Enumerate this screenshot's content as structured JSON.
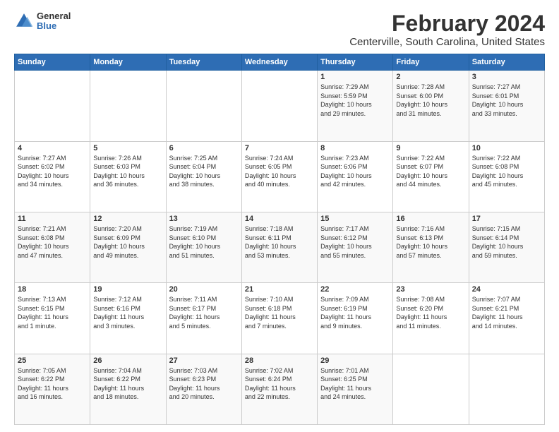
{
  "logo": {
    "general": "General",
    "blue": "Blue"
  },
  "title": "February 2024",
  "subtitle": "Centerville, South Carolina, United States",
  "days_of_week": [
    "Sunday",
    "Monday",
    "Tuesday",
    "Wednesday",
    "Thursday",
    "Friday",
    "Saturday"
  ],
  "weeks": [
    [
      {
        "day": "",
        "info": ""
      },
      {
        "day": "",
        "info": ""
      },
      {
        "day": "",
        "info": ""
      },
      {
        "day": "",
        "info": ""
      },
      {
        "day": "1",
        "info": "Sunrise: 7:29 AM\nSunset: 5:59 PM\nDaylight: 10 hours\nand 29 minutes."
      },
      {
        "day": "2",
        "info": "Sunrise: 7:28 AM\nSunset: 6:00 PM\nDaylight: 10 hours\nand 31 minutes."
      },
      {
        "day": "3",
        "info": "Sunrise: 7:27 AM\nSunset: 6:01 PM\nDaylight: 10 hours\nand 33 minutes."
      }
    ],
    [
      {
        "day": "4",
        "info": "Sunrise: 7:27 AM\nSunset: 6:02 PM\nDaylight: 10 hours\nand 34 minutes."
      },
      {
        "day": "5",
        "info": "Sunrise: 7:26 AM\nSunset: 6:03 PM\nDaylight: 10 hours\nand 36 minutes."
      },
      {
        "day": "6",
        "info": "Sunrise: 7:25 AM\nSunset: 6:04 PM\nDaylight: 10 hours\nand 38 minutes."
      },
      {
        "day": "7",
        "info": "Sunrise: 7:24 AM\nSunset: 6:05 PM\nDaylight: 10 hours\nand 40 minutes."
      },
      {
        "day": "8",
        "info": "Sunrise: 7:23 AM\nSunset: 6:06 PM\nDaylight: 10 hours\nand 42 minutes."
      },
      {
        "day": "9",
        "info": "Sunrise: 7:22 AM\nSunset: 6:07 PM\nDaylight: 10 hours\nand 44 minutes."
      },
      {
        "day": "10",
        "info": "Sunrise: 7:22 AM\nSunset: 6:08 PM\nDaylight: 10 hours\nand 45 minutes."
      }
    ],
    [
      {
        "day": "11",
        "info": "Sunrise: 7:21 AM\nSunset: 6:08 PM\nDaylight: 10 hours\nand 47 minutes."
      },
      {
        "day": "12",
        "info": "Sunrise: 7:20 AM\nSunset: 6:09 PM\nDaylight: 10 hours\nand 49 minutes."
      },
      {
        "day": "13",
        "info": "Sunrise: 7:19 AM\nSunset: 6:10 PM\nDaylight: 10 hours\nand 51 minutes."
      },
      {
        "day": "14",
        "info": "Sunrise: 7:18 AM\nSunset: 6:11 PM\nDaylight: 10 hours\nand 53 minutes."
      },
      {
        "day": "15",
        "info": "Sunrise: 7:17 AM\nSunset: 6:12 PM\nDaylight: 10 hours\nand 55 minutes."
      },
      {
        "day": "16",
        "info": "Sunrise: 7:16 AM\nSunset: 6:13 PM\nDaylight: 10 hours\nand 57 minutes."
      },
      {
        "day": "17",
        "info": "Sunrise: 7:15 AM\nSunset: 6:14 PM\nDaylight: 10 hours\nand 59 minutes."
      }
    ],
    [
      {
        "day": "18",
        "info": "Sunrise: 7:13 AM\nSunset: 6:15 PM\nDaylight: 11 hours\nand 1 minute."
      },
      {
        "day": "19",
        "info": "Sunrise: 7:12 AM\nSunset: 6:16 PM\nDaylight: 11 hours\nand 3 minutes."
      },
      {
        "day": "20",
        "info": "Sunrise: 7:11 AM\nSunset: 6:17 PM\nDaylight: 11 hours\nand 5 minutes."
      },
      {
        "day": "21",
        "info": "Sunrise: 7:10 AM\nSunset: 6:18 PM\nDaylight: 11 hours\nand 7 minutes."
      },
      {
        "day": "22",
        "info": "Sunrise: 7:09 AM\nSunset: 6:19 PM\nDaylight: 11 hours\nand 9 minutes."
      },
      {
        "day": "23",
        "info": "Sunrise: 7:08 AM\nSunset: 6:20 PM\nDaylight: 11 hours\nand 11 minutes."
      },
      {
        "day": "24",
        "info": "Sunrise: 7:07 AM\nSunset: 6:21 PM\nDaylight: 11 hours\nand 14 minutes."
      }
    ],
    [
      {
        "day": "25",
        "info": "Sunrise: 7:05 AM\nSunset: 6:22 PM\nDaylight: 11 hours\nand 16 minutes."
      },
      {
        "day": "26",
        "info": "Sunrise: 7:04 AM\nSunset: 6:22 PM\nDaylight: 11 hours\nand 18 minutes."
      },
      {
        "day": "27",
        "info": "Sunrise: 7:03 AM\nSunset: 6:23 PM\nDaylight: 11 hours\nand 20 minutes."
      },
      {
        "day": "28",
        "info": "Sunrise: 7:02 AM\nSunset: 6:24 PM\nDaylight: 11 hours\nand 22 minutes."
      },
      {
        "day": "29",
        "info": "Sunrise: 7:01 AM\nSunset: 6:25 PM\nDaylight: 11 hours\nand 24 minutes."
      },
      {
        "day": "",
        "info": ""
      },
      {
        "day": "",
        "info": ""
      }
    ]
  ]
}
